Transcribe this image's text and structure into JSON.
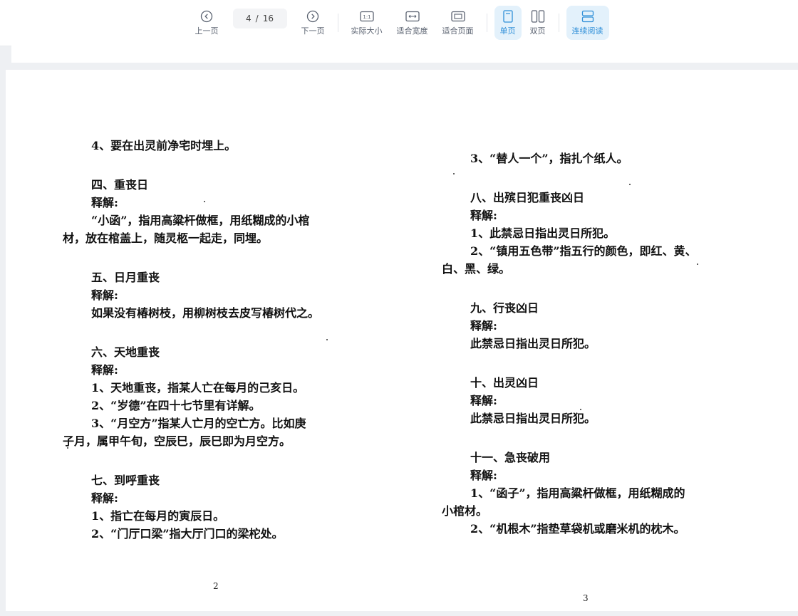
{
  "toolbar": {
    "prev_label": "上一页",
    "current_page": "4",
    "page_sep": "/",
    "total_pages": "16",
    "next_label": "下一页",
    "actual_size_label": "实际大小",
    "actual_size_icon_text": "1:1",
    "fit_width_label": "适合宽度",
    "fit_page_label": "适合页面",
    "single_page_label": "单页",
    "double_page_label": "双页",
    "continuous_label": "连续阅读",
    "active_color": "#2f8fd8"
  },
  "left_page": {
    "page_number": "2",
    "lines": [
      "4、要在出灵前净宅时埋上。",
      "四、重丧日",
      "释解:",
      "“小函”，指用高粱杆做框，用纸糊成的小棺",
      "材，放在棺盖上，随灵柩一起走，同埋。",
      "五、日月重丧",
      "释解:",
      "如果没有椿树枝，用柳树枝去皮写椿树代之。",
      "六、天地重丧",
      "释解:",
      "1、天地重丧，指某人亡在每月的己亥日。",
      "2、“岁德”在四十七节里有详解。",
      "3、“月空方”指某人亡月的空亡方。比如庚",
      "子月，属甲午旬，空辰巳，辰巳即为月空方。",
      "七、到呼重丧",
      "释解:",
      "1、指亡在每月的寅辰日。",
      "2、“门厅口梁”指大厅门口的梁柁处。"
    ]
  },
  "right_page": {
    "page_number": "3",
    "lines": [
      "3、“替人一个”，指扎个纸人。",
      "八、出殡日犯重丧凶日",
      "释解:",
      "1、此禁忌日指出灵日所犯。",
      "2、“镇用五色带”指五行的颜色，即红、黄、",
      "白、黑、绿。",
      "九、行丧凶日",
      "释解:",
      "此禁忌日指出灵日所犯。",
      "十、出灵凶日",
      "释解:",
      "此禁忌日指出灵日所犯。",
      "十一、急丧破用",
      "释解:",
      "1、“函子”，指用高粱杆做框，用纸糊成的",
      "小棺材。",
      "2、“机根木”指垫草袋机或磨米机的枕木。"
    ]
  }
}
